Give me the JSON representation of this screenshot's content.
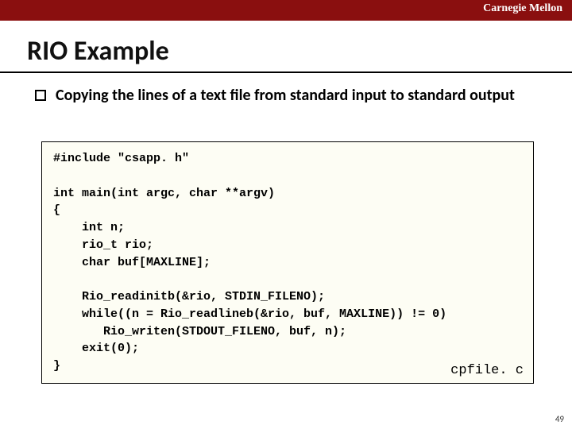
{
  "header": {
    "brand": "Carnegie Mellon"
  },
  "title": "RIO Example",
  "bullet": "Copying the lines of a text file from standard input to standard output",
  "code_lines": [
    "#include \"csapp. h\"",
    "",
    "int main(int argc, char **argv)",
    "{",
    "    int n;",
    "    rio_t rio;",
    "    char buf[MAXLINE];",
    "",
    "    Rio_readinitb(&rio, STDIN_FILENO);",
    "    while((n = Rio_readlineb(&rio, buf, MAXLINE)) != 0)",
    "       Rio_writen(STDOUT_FILENO, buf, n);",
    "    exit(0);",
    "}"
  ],
  "file_label": "cpfile. c",
  "page_number": "49"
}
